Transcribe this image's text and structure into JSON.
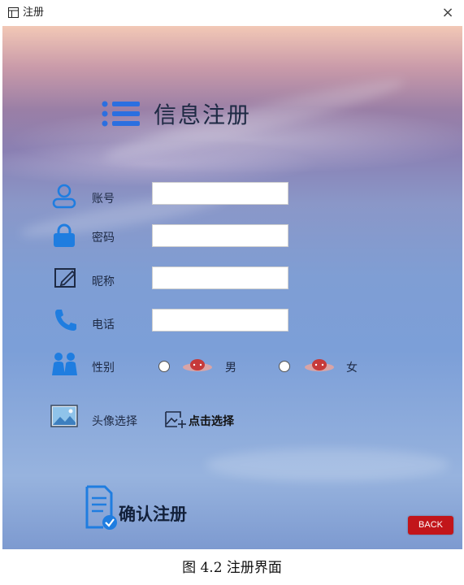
{
  "window": {
    "title": "注册",
    "close_glyph": "×"
  },
  "header": {
    "title": "信息注册",
    "icon": "list-icon",
    "icon_color": "#2b6fe0"
  },
  "form": {
    "account": {
      "label": "账号",
      "value": "",
      "icon": "user-icon"
    },
    "password": {
      "label": "密码",
      "value": "",
      "icon": "lock-icon"
    },
    "nickname": {
      "label": "昵称",
      "value": "",
      "icon": "edit-icon"
    },
    "phone": {
      "label": "电话",
      "value": "",
      "icon": "phone-icon"
    },
    "gender": {
      "label": "性别",
      "icon": "people-icon",
      "options": [
        {
          "label": "男",
          "checked": false
        },
        {
          "label": "女",
          "checked": false
        }
      ]
    },
    "avatar": {
      "label": "头像选择",
      "pick_label": "点击选择",
      "icon": "image-icon",
      "pick_icon": "add-image-icon"
    }
  },
  "actions": {
    "confirm_label": "确认注册",
    "back_label": "BACK",
    "back_color": "#c2151a"
  },
  "caption": "图 4.2 注册界面",
  "theme": {
    "accent": "#1f7de0",
    "background": "sky-gradient"
  }
}
